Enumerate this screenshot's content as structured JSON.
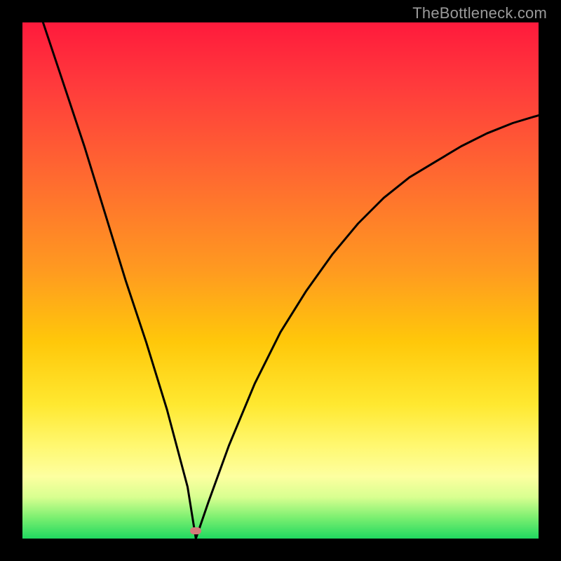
{
  "watermark": "TheBottleneck.com",
  "colors": {
    "frame": "#000000",
    "curve": "#000000",
    "marker": "#d47a7a",
    "gradient_stops": [
      "#ff1a3c",
      "#ff3a3c",
      "#ff6a30",
      "#ff9a20",
      "#ffc80a",
      "#ffe830",
      "#fff870",
      "#fdffa0",
      "#d8ff90",
      "#7aef70",
      "#20d860"
    ]
  },
  "chart_data": {
    "type": "line",
    "title": "",
    "xlabel": "",
    "ylabel": "",
    "xlim": [
      0,
      100
    ],
    "ylim": [
      0,
      100
    ],
    "grid": false,
    "legend": false,
    "series": [
      {
        "name": "bottleneck-curve",
        "x": [
          4,
          8,
          12,
          16,
          20,
          24,
          28,
          32,
          33.6,
          36,
          40,
          45,
          50,
          55,
          60,
          65,
          70,
          75,
          80,
          85,
          90,
          95,
          100
        ],
        "y": [
          100,
          88,
          76,
          63,
          50,
          38,
          25,
          10,
          0,
          7,
          18,
          30,
          40,
          48,
          55,
          61,
          66,
          70,
          73,
          76,
          78.5,
          80.5,
          82
        ]
      }
    ],
    "annotations": [
      {
        "name": "minimum-marker",
        "x": 33.6,
        "y": 1.5
      }
    ]
  }
}
